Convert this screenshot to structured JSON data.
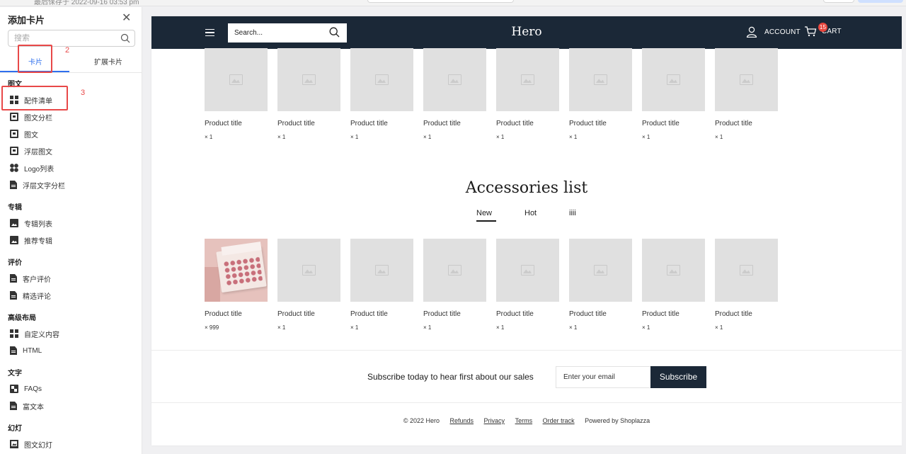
{
  "top_strip": {
    "saved_text": "最后保存于 2022-09-16 03:53 pm"
  },
  "sidebar": {
    "title": "添加卡片",
    "search_placeholder": "搜索",
    "tabs": [
      {
        "label": "卡片"
      },
      {
        "label": "扩展卡片"
      }
    ],
    "annotations": {
      "tab_marker": "2",
      "item_marker": "3"
    },
    "groups": [
      {
        "title": "图文",
        "items": [
          {
            "label": "配件清单",
            "icon": "grid-icon"
          },
          {
            "label": "图文分栏",
            "icon": "image-text-icon"
          },
          {
            "label": "图文",
            "icon": "image-text-icon"
          },
          {
            "label": "浮层图文",
            "icon": "image-text-icon"
          },
          {
            "label": "Logo列表",
            "icon": "dots-grid-icon"
          },
          {
            "label": "浮层文字分栏",
            "icon": "document-icon"
          }
        ]
      },
      {
        "title": "专辑",
        "items": [
          {
            "label": "专辑列表",
            "icon": "picture-icon"
          },
          {
            "label": "推荐专辑",
            "icon": "picture-icon"
          }
        ]
      },
      {
        "title": "评价",
        "items": [
          {
            "label": "客户评价",
            "icon": "document-icon"
          },
          {
            "label": "精选评论",
            "icon": "document-icon"
          }
        ]
      },
      {
        "title": "高级布局",
        "items": [
          {
            "label": "自定义内容",
            "icon": "grid-icon"
          },
          {
            "label": "HTML",
            "icon": "document-icon"
          }
        ]
      },
      {
        "title": "文字",
        "items": [
          {
            "label": "FAQs",
            "icon": "faq-icon"
          },
          {
            "label": "富文本",
            "icon": "document-icon"
          }
        ]
      },
      {
        "title": "幻灯",
        "items": [
          {
            "label": "图文幻灯",
            "icon": "slideshow-icon"
          }
        ]
      }
    ]
  },
  "store": {
    "header": {
      "search_placeholder": "Search...",
      "brand": "Hero",
      "account_label": "ACCOUNT",
      "cart_label": "CART",
      "cart_count": "15",
      "bg_color": "#1b2837"
    },
    "top_products": [
      {
        "title": "Product title",
        "qty": "× 1"
      },
      {
        "title": "Product title",
        "qty": "× 1"
      },
      {
        "title": "Product title",
        "qty": "× 1"
      },
      {
        "title": "Product title",
        "qty": "× 1"
      },
      {
        "title": "Product title",
        "qty": "× 1"
      },
      {
        "title": "Product title",
        "qty": "× 1"
      },
      {
        "title": "Product title",
        "qty": "× 1"
      },
      {
        "title": "Product title",
        "qty": "× 1"
      }
    ],
    "accessories": {
      "title": "Accessories list",
      "tabs": [
        {
          "label": "New",
          "active": true
        },
        {
          "label": "Hot"
        },
        {
          "label": "iiii"
        }
      ],
      "products": [
        {
          "title": "Product title",
          "qty": "× 999",
          "has_image": true
        },
        {
          "title": "Product title",
          "qty": "× 1"
        },
        {
          "title": "Product title",
          "qty": "× 1"
        },
        {
          "title": "Product title",
          "qty": "× 1"
        },
        {
          "title": "Product title",
          "qty": "× 1"
        },
        {
          "title": "Product title",
          "qty": "× 1"
        },
        {
          "title": "Product title",
          "qty": "× 1"
        },
        {
          "title": "Product title",
          "qty": "× 1"
        }
      ]
    },
    "subscribe": {
      "text": "Subscribe today to hear first about our sales",
      "placeholder": "Enter your email",
      "button": "Subscribe"
    },
    "footer": {
      "copyright": "© 2022 Hero",
      "links": [
        "Refunds",
        "Privacy",
        "Terms",
        "Order track"
      ],
      "powered": "Powered by Shoplazza"
    }
  }
}
